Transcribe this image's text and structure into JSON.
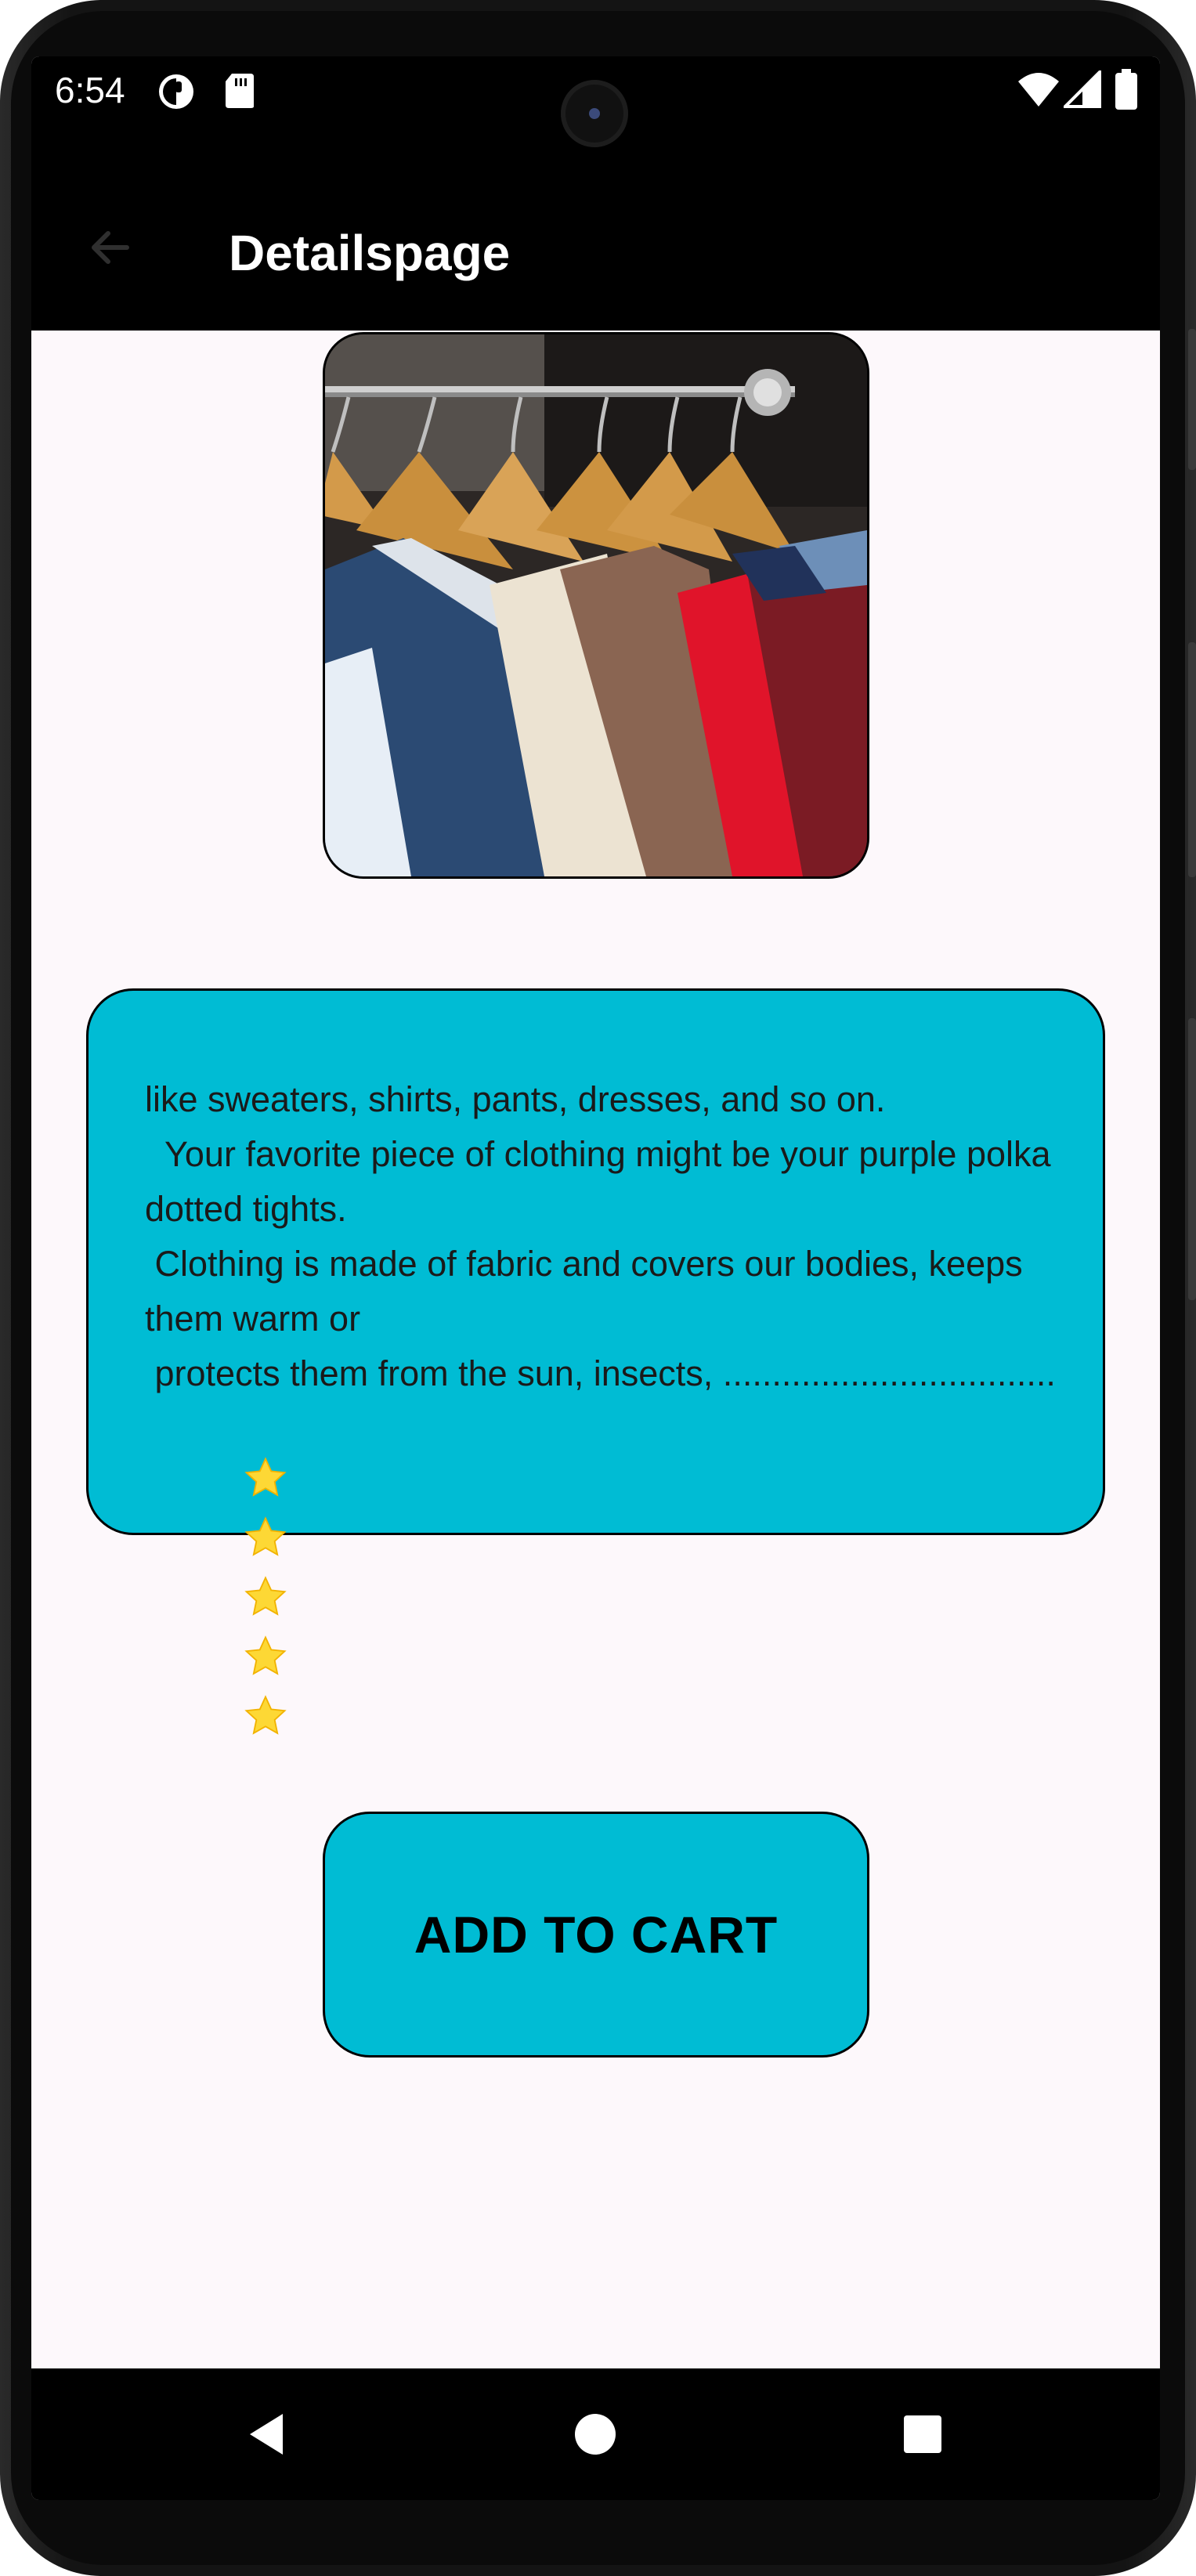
{
  "status_bar": {
    "time": "6:54",
    "icons": [
      "privacy-indicator-icon",
      "sd-card-icon",
      "wifi-icon",
      "signal-icon",
      "battery-icon"
    ]
  },
  "app_bar": {
    "title": "Detailspage",
    "back_icon": "arrow-back-icon"
  },
  "product": {
    "image_subject": "clothes on hangers",
    "description": "like sweaters, shirts, pants, dresses, and so on.\n  Your favorite piece of clothing might be your purple polka dotted tights.\n Clothing is made of fabric and covers our bodies, keeps them warm or\n protects them from the sun, insects, ..................................",
    "rating": 5,
    "rating_icon": "star-icon"
  },
  "cart": {
    "label": "ADD TO CART"
  },
  "nav_bar": {
    "icons": [
      "back-triangle-icon",
      "home-circle-icon",
      "recents-square-icon"
    ]
  },
  "colors": {
    "accent": "#00bcd4",
    "app_bar": "#000000",
    "background": "#fdf8fb",
    "star": "#fdd835"
  }
}
